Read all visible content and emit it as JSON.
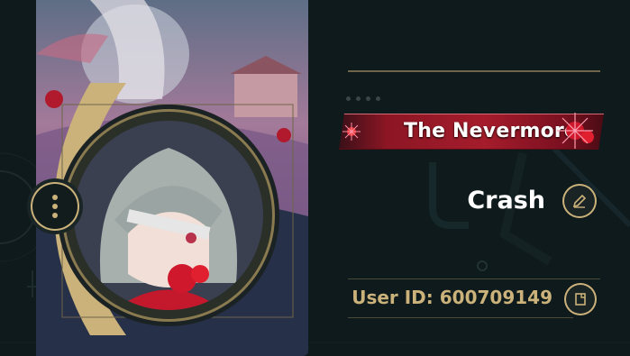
{
  "profile": {
    "title_badge": "The Nevermore",
    "username": "Crash",
    "user_id": "User ID: 600709149"
  },
  "icons": {
    "menu": "more-vertical-icon",
    "edit": "pencil-icon",
    "copy": "copy-icon"
  },
  "colors": {
    "accent_gold": "#cbb27a",
    "background": "#0e1a1b",
    "badge_red": "#a51c2c"
  }
}
